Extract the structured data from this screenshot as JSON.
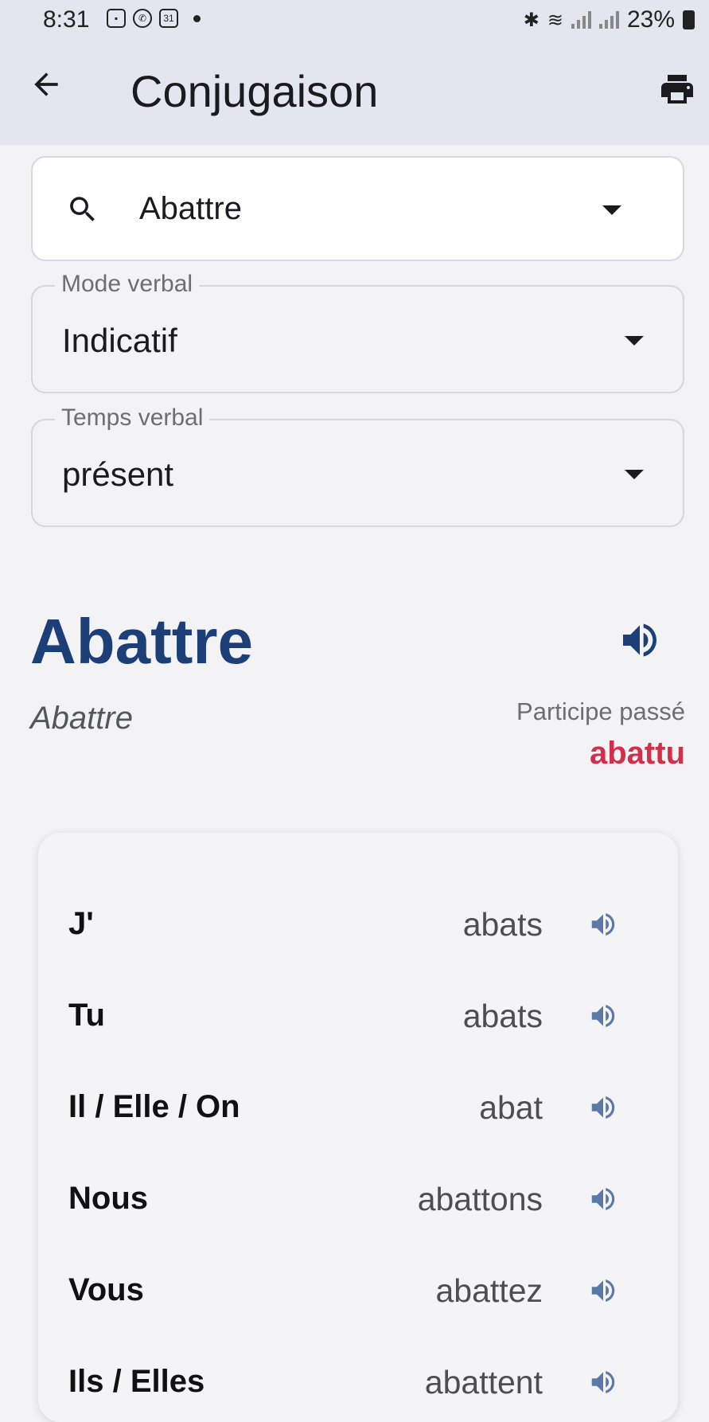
{
  "status_bar": {
    "time": "8:31",
    "calendar_day": "31",
    "battery": "23%"
  },
  "appbar": {
    "title": "Conjugaison"
  },
  "search": {
    "value": "Abattre"
  },
  "mode_field": {
    "label": "Mode verbal",
    "value": "Indicatif"
  },
  "tense_field": {
    "label": "Temps verbal",
    "value": "présent"
  },
  "verb": {
    "title": "Abattre",
    "subtitle": "Abattre",
    "participle_label": "Participe passé",
    "participle_value": "abattu"
  },
  "conjugation": [
    {
      "pronoun": "J'",
      "form": "abats"
    },
    {
      "pronoun": "Tu",
      "form": "abats"
    },
    {
      "pronoun": "Il / Elle / On",
      "form": "abat"
    },
    {
      "pronoun": "Nous",
      "form": "abattons"
    },
    {
      "pronoun": "Vous",
      "form": "abattez"
    },
    {
      "pronoun": "Ils / Elles",
      "form": "abattent"
    }
  ],
  "colors": {
    "accent_blue": "#1d3f78",
    "participle_red": "#d32e4a",
    "speaker_light": "#5b79a8"
  }
}
